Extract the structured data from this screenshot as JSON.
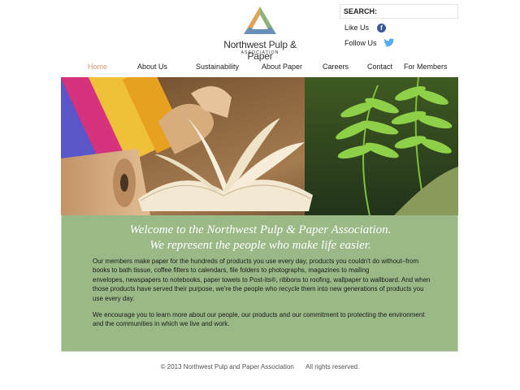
{
  "header": {
    "logo": {
      "name": "Northwest Pulp & Paper",
      "sub": "ASSOCIATION",
      "icon": "triangle-logo-icon",
      "colors": [
        "#8cb37a",
        "#e2a25a",
        "#6a8fb8"
      ]
    },
    "search": {
      "label": "SEARCH:",
      "placeholder": "",
      "value": ""
    },
    "social": [
      {
        "label": "Like Us",
        "icon": "facebook-icon",
        "color": "#3b5998"
      },
      {
        "label": "Follow Us",
        "icon": "twitter-icon",
        "color": "#55acee"
      }
    ]
  },
  "nav": {
    "items": [
      {
        "label": "Home",
        "active": true
      },
      {
        "label": "About Us",
        "active": false
      },
      {
        "label": "Sustainability",
        "active": false
      },
      {
        "label": "About Paper",
        "active": false
      },
      {
        "label": "Careers",
        "active": false
      },
      {
        "label": "Contact",
        "active": false
      },
      {
        "label": "For Members",
        "active": false
      }
    ],
    "active_color": "#d99a6c"
  },
  "hero": {
    "icon": "hero-paper-products-image"
  },
  "welcome": {
    "title_line1": "Welcome to the Northwest Pulp & Paper Association.",
    "title_line2": "We represent the people who make life easier.",
    "paragraph1_lines": [
      "Our members make paper for the hundreds of products you use every day, products you couldn't do without–from",
      "books to bath tissue, coffee filters to calendars, file folders to photographs, magazines to mailing",
      "envelopes, newspapers to notebooks, paper towels to Post-its®, ribbons to roofing, wallpaper to wallboard. And when",
      "those products have served their purpose, we're the people who recycle them into new generations of products you",
      "use every day."
    ],
    "paragraph2_lines": [
      "We encourage you to learn more about our people, our products and our commitment to protecting the environment",
      "and the communities in which we live and work."
    ],
    "background": "#9bb987"
  },
  "footer": {
    "copyright": "© 2013 Northwest Pulp and Paper Association",
    "rights": "All rights reserved."
  }
}
